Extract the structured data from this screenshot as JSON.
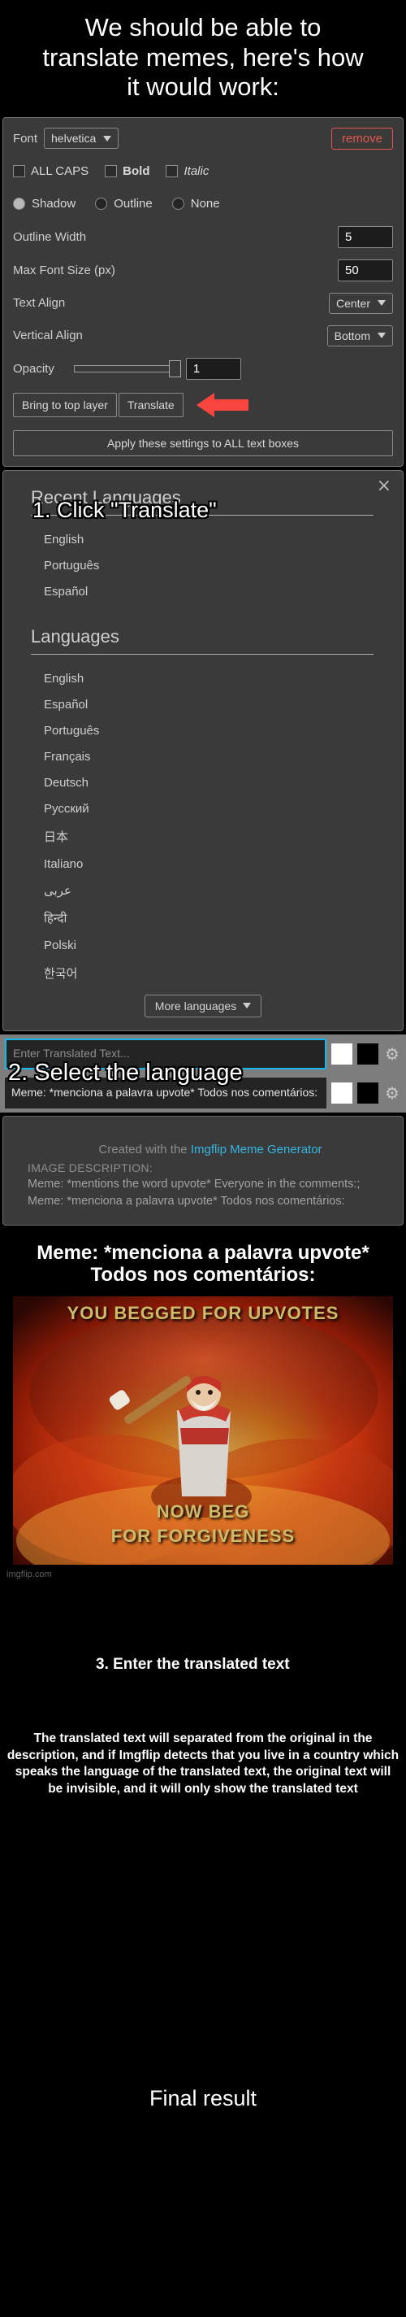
{
  "top_caption": "We should be able to translate memes, here's how it would work:",
  "instructions": {
    "step1": "1. Click \"Translate\"",
    "step2": "2. Select the language",
    "step3": "3. Enter the translated text",
    "note": "The translated text will separated from the original in the description, and if Imgflip detects that you live in a country which speaks the language of the translated text, the original text will be invisible, and it will only show the translated text",
    "final": "Final result"
  },
  "settings": {
    "font_label": "Font",
    "font_value": "helvetica",
    "remove_label": "remove",
    "checkboxes": [
      {
        "label": "ALL CAPS",
        "checked": false,
        "style": "normal"
      },
      {
        "label": "Bold",
        "checked": false,
        "style": "bold"
      },
      {
        "label": "Italic",
        "checked": false,
        "style": "italic"
      }
    ],
    "radios": [
      {
        "label": "Shadow",
        "selected": true
      },
      {
        "label": "Outline",
        "selected": false
      },
      {
        "label": "None",
        "selected": false
      }
    ],
    "outline_width_label": "Outline Width",
    "outline_width_value": "5",
    "max_font_size_label": "Max Font Size (px)",
    "max_font_size_value": "50",
    "text_align_label": "Text Align",
    "text_align_value": "Center",
    "vertical_align_label": "Vertical Align",
    "vertical_align_value": "Bottom",
    "opacity_label": "Opacity",
    "opacity_value": "1",
    "bring_to_top_label": "Bring to top layer",
    "translate_label": "Translate",
    "apply_all_label": "Apply these settings to ALL text boxes",
    "arrow_color": "#f8453f"
  },
  "languages_dialog": {
    "close_label": "×",
    "recent_heading": "Recent Languages",
    "recent": [
      "English",
      "Português",
      "Español"
    ],
    "all_heading": "Languages",
    "all": [
      "English",
      "Español",
      "Português",
      "Français",
      "Deutsch",
      "Русский",
      "日本",
      "Italiano",
      "عربى",
      "हिन्दी",
      "Polski",
      "한국어"
    ],
    "more_label": "More languages"
  },
  "inputs": {
    "translated_placeholder": "Enter Translated Text...",
    "translated_value": "",
    "original_value": "Meme: *menciona a palavra upvote* Todos nos comentários:",
    "gear_icon": "gear-icon",
    "swatch_white": "#ffffff",
    "swatch_black": "#000000",
    "focus_color": "#16b6e8"
  },
  "description_panel": {
    "created_prefix": "Created with the ",
    "created_link": "Imgflip Meme Generator",
    "image_description_label": "IMAGE DESCRIPTION:",
    "image_description_body": "Meme: *mentions the word upvote* Everyone in the comments:; Meme: *menciona a palavra upvote* Todos nos comentários:"
  },
  "final_meme": {
    "top_text": "Meme: *menciona a palavra upvote* Todos nos comentários:",
    "caption_top": "YOU BEGGED FOR UPVOTES",
    "caption_bottom_1": "NOW BEG",
    "caption_bottom_2": "FOR FORGIVENESS"
  },
  "footer": {
    "brand": "imgflip.com"
  }
}
